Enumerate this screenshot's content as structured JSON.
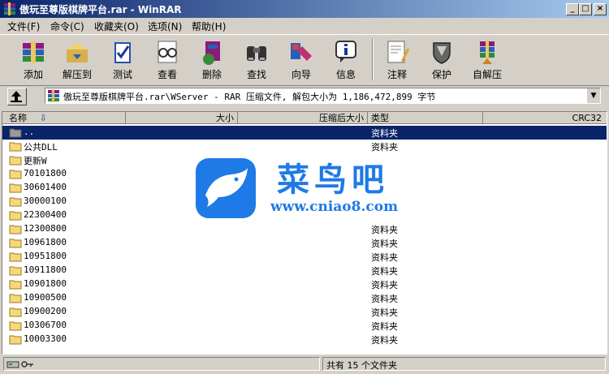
{
  "window": {
    "title": "傲玩至尊版棋牌平台.rar - WinRAR"
  },
  "menu": [
    "文件(F)",
    "命令(C)",
    "收藏夹(O)",
    "选项(N)",
    "帮助(H)"
  ],
  "toolbar": [
    {
      "label": "添加",
      "icon": "add-archive-icon"
    },
    {
      "label": "解压到",
      "icon": "extract-to-icon"
    },
    {
      "label": "测试",
      "icon": "test-icon"
    },
    {
      "label": "查看",
      "icon": "view-icon"
    },
    {
      "label": "删除",
      "icon": "delete-icon"
    },
    {
      "label": "查找",
      "icon": "find-icon"
    },
    {
      "label": "向导",
      "icon": "wizard-icon"
    },
    {
      "label": "信息",
      "icon": "info-icon"
    },
    {
      "label": "注释",
      "icon": "comment-icon"
    },
    {
      "label": "保护",
      "icon": "protect-icon"
    },
    {
      "label": "自解压",
      "icon": "sfx-icon"
    }
  ],
  "address": {
    "path": "傲玩至尊版棋牌平台.rar\\WServer - RAR 压缩文件, 解包大小为 1,186,472,899 字节"
  },
  "columns": {
    "name": "名称",
    "size": "大小",
    "packed": "压缩后大小",
    "type": "类型",
    "crc": "CRC32"
  },
  "files": [
    {
      "name": "..",
      "type": "资料夹",
      "selected": true
    },
    {
      "name": "公共DLL",
      "type": "资料夹"
    },
    {
      "name": "更新W",
      "type": ""
    },
    {
      "name": "70101800",
      "type": ""
    },
    {
      "name": "30601400",
      "type": ""
    },
    {
      "name": "30000100",
      "type": ""
    },
    {
      "name": "22300400",
      "type": ""
    },
    {
      "name": "12300800",
      "type": "资料夹"
    },
    {
      "name": "10961800",
      "type": "资料夹"
    },
    {
      "name": "10951800",
      "type": "资料夹"
    },
    {
      "name": "10911800",
      "type": "资料夹"
    },
    {
      "name": "10901800",
      "type": "资料夹"
    },
    {
      "name": "10900500",
      "type": "资料夹"
    },
    {
      "name": "10900200",
      "type": "资料夹"
    },
    {
      "name": "10306700",
      "type": "资料夹"
    },
    {
      "name": "10003300",
      "type": "资料夹"
    }
  ],
  "status": {
    "text": "共有 15 个文件夹"
  },
  "watermark": {
    "brand": "菜鸟吧",
    "url": "www.cniao8.com"
  },
  "colors": {
    "title_start": "#0a246a",
    "title_end": "#a6caf0",
    "selection": "#0a246a",
    "watermark_blue": "#1e7ae6"
  }
}
